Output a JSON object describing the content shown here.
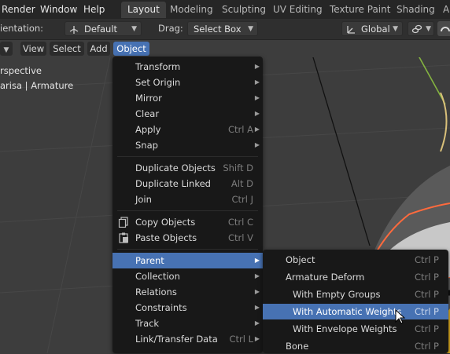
{
  "topbar": {
    "menus": [
      "Render",
      "Window",
      "Help"
    ],
    "workspaces": [
      "Layout",
      "Modeling",
      "Sculpting",
      "UV Editing",
      "Texture Paint",
      "Shading",
      "An"
    ]
  },
  "toolbar": {
    "orientation_label": "ientation:",
    "orientation_value": "Default",
    "drag_label": "Drag:",
    "drag_value": "Select Box",
    "transform_orientation": "Global"
  },
  "viewport_header": {
    "menus": [
      "View",
      "Select",
      "Add",
      "Object"
    ]
  },
  "viewport": {
    "overlay_line1": "rspective",
    "overlay_line2": "arisa | Armature"
  },
  "object_menu": {
    "items": [
      {
        "label": "Transform",
        "shortcut": "",
        "submenu": true
      },
      {
        "label": "Set Origin",
        "shortcut": "",
        "submenu": true
      },
      {
        "label": "Mirror",
        "shortcut": "",
        "submenu": true
      },
      {
        "label": "Clear",
        "shortcut": "",
        "submenu": true
      },
      {
        "label": "Apply",
        "shortcut": "Ctrl A",
        "submenu": true
      },
      {
        "label": "Snap",
        "shortcut": "",
        "submenu": true
      },
      {
        "label": "Duplicate Objects",
        "shortcut": "Shift D",
        "submenu": false
      },
      {
        "label": "Duplicate Linked",
        "shortcut": "Alt D",
        "submenu": false
      },
      {
        "label": "Join",
        "shortcut": "Ctrl J",
        "submenu": false
      },
      {
        "label": "Copy Objects",
        "shortcut": "Ctrl C",
        "submenu": false,
        "icon": "copy-icon"
      },
      {
        "label": "Paste Objects",
        "shortcut": "Ctrl V",
        "submenu": false,
        "icon": "paste-icon"
      },
      {
        "label": "Parent",
        "shortcut": "",
        "submenu": true,
        "highlighted": true
      },
      {
        "label": "Collection",
        "shortcut": "",
        "submenu": true
      },
      {
        "label": "Relations",
        "shortcut": "",
        "submenu": true
      },
      {
        "label": "Constraints",
        "shortcut": "",
        "submenu": true
      },
      {
        "label": "Track",
        "shortcut": "",
        "submenu": true
      },
      {
        "label": "Link/Transfer Data",
        "shortcut": "Ctrl L",
        "submenu": true
      }
    ]
  },
  "parent_menu": {
    "items": [
      {
        "label": "Object",
        "shortcut": "Ctrl P"
      },
      {
        "label": "Armature Deform",
        "shortcut": "Ctrl P"
      },
      {
        "label": "With Empty Groups",
        "shortcut": "Ctrl P"
      },
      {
        "label": "With Automatic Weights",
        "shortcut": "Ctrl P",
        "highlighted": true
      },
      {
        "label": "With Envelope Weights",
        "shortcut": "Ctrl P"
      },
      {
        "label": "Bone",
        "shortcut": "Ctrl P"
      }
    ]
  },
  "colors": {
    "accent": "#4772b3",
    "menu_bg": "#181818",
    "viewport_bg": "#3d3d3d",
    "selection_outline": "#ff6a3d"
  }
}
